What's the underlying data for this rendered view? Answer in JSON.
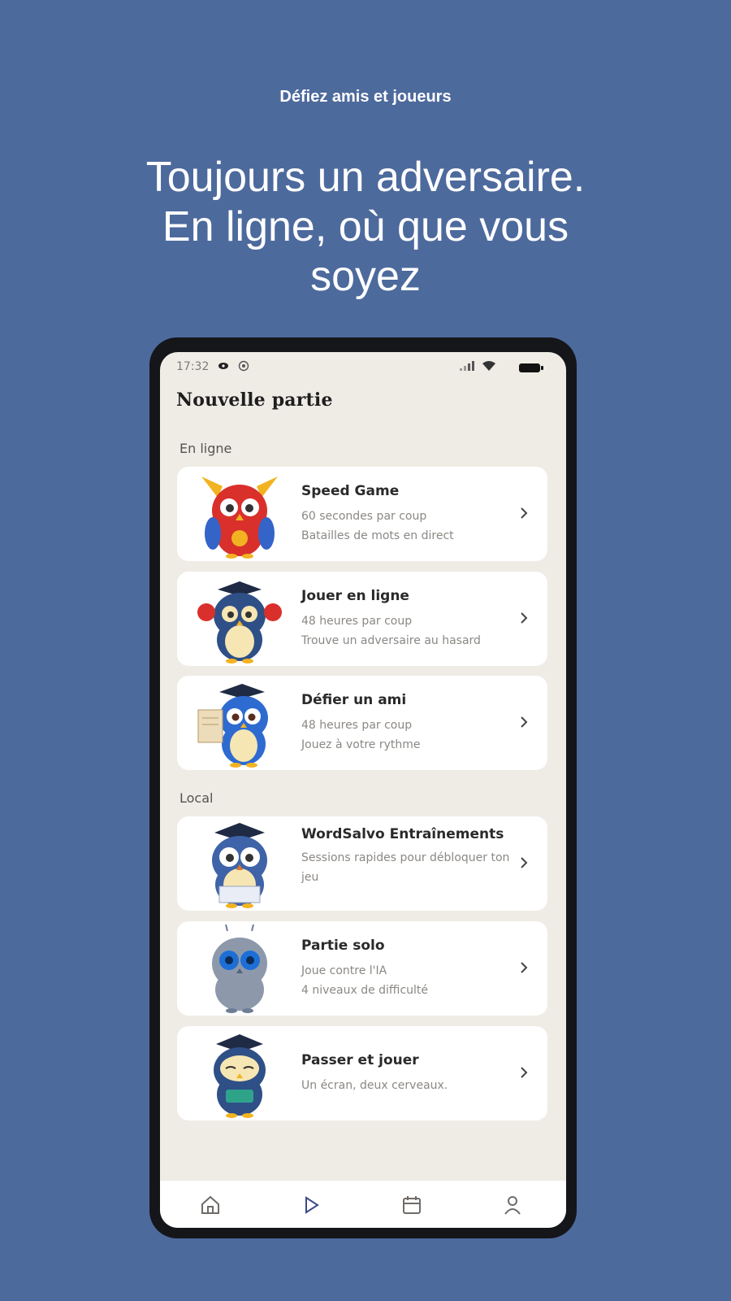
{
  "kicker": "Défiez amis et joueurs",
  "headline": "Toujours un adversaire. En ligne, où que vous soyez",
  "status_bar": {
    "time": "17:32",
    "icons": [
      "cast-icon",
      "circle-icon",
      "signal-icon",
      "wifi-icon",
      "battery-icon"
    ]
  },
  "screen_title": "Nouvelle partie",
  "sections": {
    "online": "En ligne",
    "local": "Local"
  },
  "cards": [
    {
      "title": "Speed Game",
      "line1": "60 secondes par coup",
      "line2": "Batailles de mots en direct",
      "owl": "speed-owl"
    },
    {
      "title": "Jouer en ligne",
      "line1": "48 heures par coup",
      "line2": "Trouve un adversaire au hasard",
      "owl": "boxing-owl"
    },
    {
      "title": "Défier un ami",
      "line1": "48 heures par coup",
      "line2": "Jouez à votre rythme",
      "owl": "letter-owl"
    },
    {
      "title": "WordSalvo Entraînements",
      "line1": "Sessions rapides pour débloquer ton jeu",
      "line2": "",
      "owl": "graduate-owl"
    },
    {
      "title": "Partie solo",
      "line1": "Joue contre l'IA",
      "line2": "4 niveaux de difficulté",
      "owl": "robot-owl"
    },
    {
      "title": "Passer et jouer",
      "line1": "Un écran, deux cerveaux.",
      "line2": "",
      "owl": "book-owl"
    }
  ],
  "nav": [
    {
      "name": "home",
      "icon": "home-icon",
      "active": false
    },
    {
      "name": "play",
      "icon": "play-icon",
      "active": true
    },
    {
      "name": "calendar",
      "icon": "calendar-icon",
      "active": false
    },
    {
      "name": "profile",
      "icon": "profile-icon",
      "active": false
    }
  ],
  "colors": {
    "background": "#4d6a9d",
    "screen": "#efece6",
    "card": "#ffffff",
    "active_nav": "#3b4a8a"
  }
}
